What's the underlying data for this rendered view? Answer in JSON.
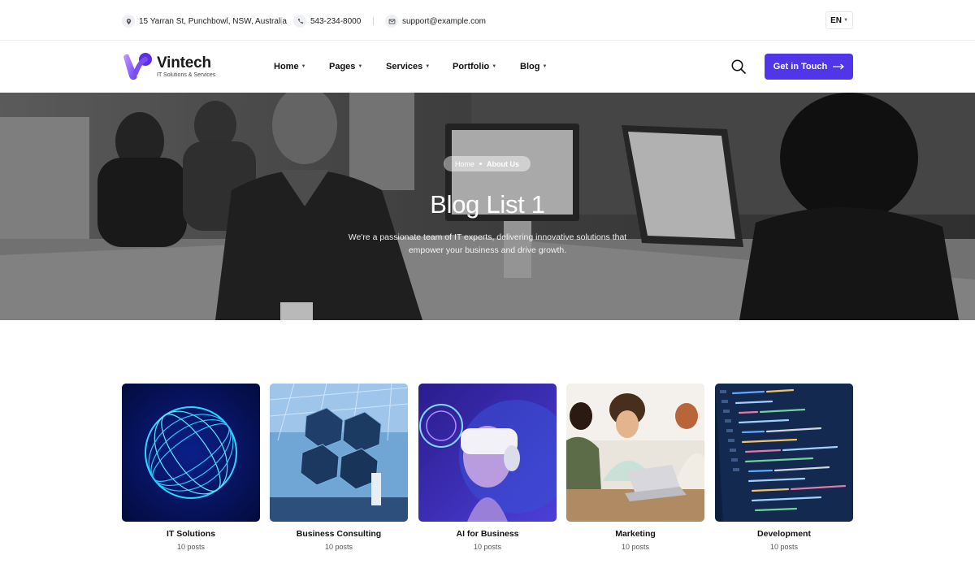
{
  "topbar": {
    "address": "15 Yarran St, Punchbowl, NSW, Australia",
    "phone": "543-234-8000",
    "email": "support@example.com",
    "language": "EN",
    "icons": {
      "address": "location-pin-icon",
      "phone": "phone-icon",
      "email": "mail-icon"
    }
  },
  "brand": {
    "name": "Vintech",
    "tagline": "IT Solutions & Services",
    "accent": "#5135e8"
  },
  "nav": {
    "items": [
      {
        "label": "Home"
      },
      {
        "label": "Pages"
      },
      {
        "label": "Services"
      },
      {
        "label": "Portfolio"
      },
      {
        "label": "Blog"
      }
    ],
    "cta_label": "Get in Touch"
  },
  "hero": {
    "breadcrumb": {
      "home": "Home",
      "current": "About Us"
    },
    "title": "Blog List 1",
    "description": "We're a passionate team of IT experts, delivering innovative solutions that empower your business and drive growth."
  },
  "categories": [
    {
      "name": "IT Solutions",
      "count": "10 posts"
    },
    {
      "name": "Business Consulting",
      "count": "10 posts"
    },
    {
      "name": "AI for Business",
      "count": "10 posts"
    },
    {
      "name": "Marketing",
      "count": "10 posts"
    },
    {
      "name": "Development",
      "count": "10 posts"
    }
  ]
}
